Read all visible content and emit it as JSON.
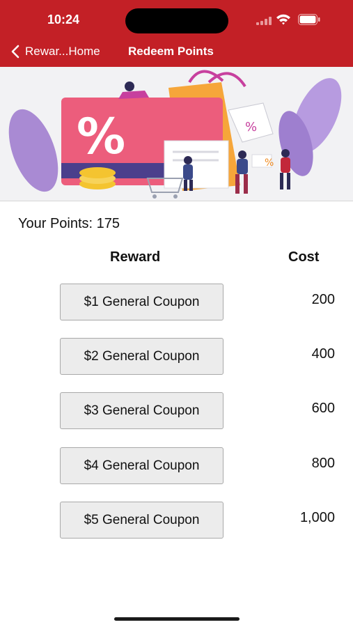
{
  "status_bar": {
    "time": "10:24"
  },
  "nav": {
    "back_label": "Rewar...Home",
    "title": "Redeem Points"
  },
  "banner": {
    "icon": "promo-sale-illustration",
    "glyph": "%"
  },
  "points": {
    "text": "Your Points: 175"
  },
  "table": {
    "col_reward": "Reward",
    "col_cost": "Cost",
    "rows": [
      {
        "label": "$1 General Coupon",
        "cost": "200"
      },
      {
        "label": "$2 General Coupon",
        "cost": "400"
      },
      {
        "label": "$3 General Coupon",
        "cost": "600"
      },
      {
        "label": "$4 General Coupon",
        "cost": "800"
      },
      {
        "label": "$5 General Coupon",
        "cost": "1,000"
      }
    ]
  },
  "colors": {
    "brand_red": "#c32026",
    "button_bg": "#ececec",
    "button_border": "#a8a8a8"
  }
}
